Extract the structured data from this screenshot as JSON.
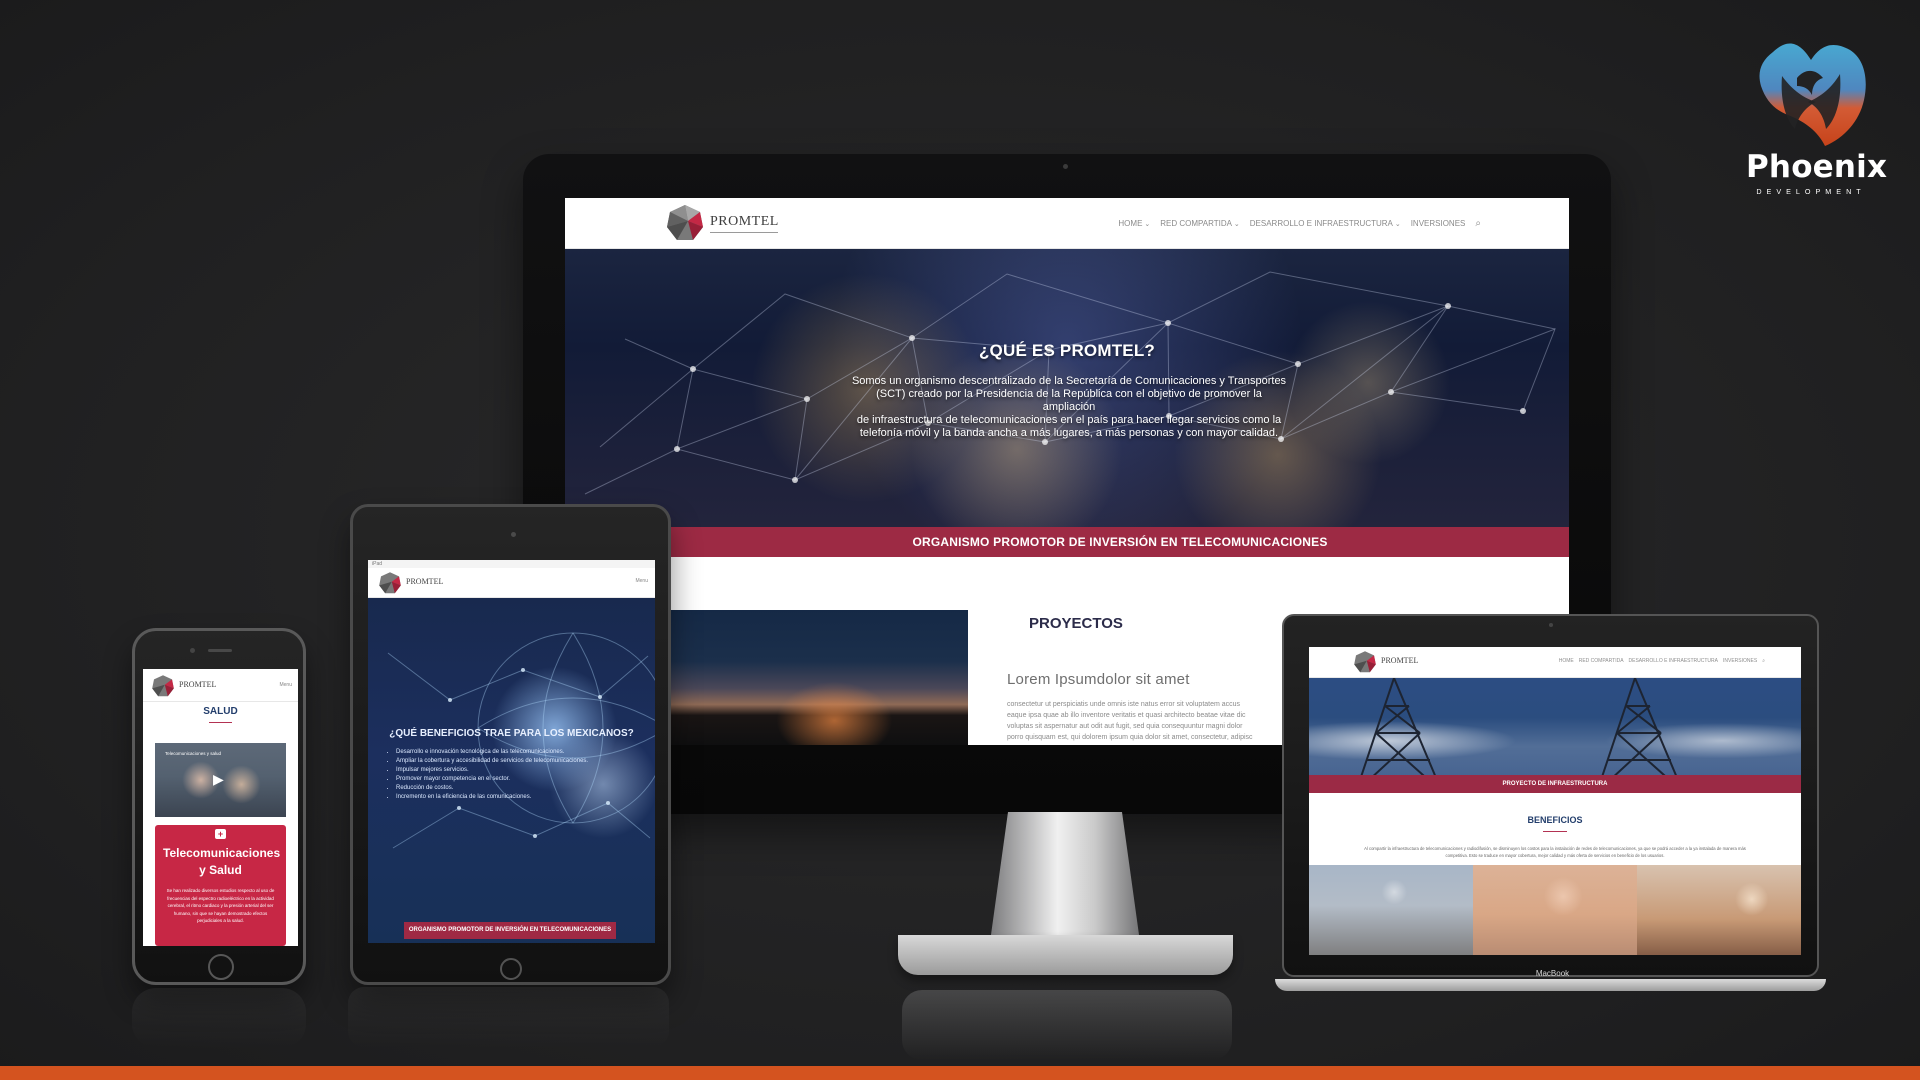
{
  "brand": {
    "name": "Phoenix",
    "tagline": "DEVELOPMENT",
    "accent": "#d4531f"
  },
  "desktop": {
    "logo": {
      "name": "PROMTEL",
      "tagline": "ORGANISMO PROMOTOR DE INVERSIÓN EN TELECOMUNICACIONES"
    },
    "nav": {
      "home": "HOME",
      "shared_network": "RED COMPARTIDA",
      "development": "DESARROLLO E INFRAESTRUCTURA",
      "investments": "INVERSIONES",
      "search": "⌕"
    },
    "hero": {
      "title": "¿QUÉ ES PROMTEL?",
      "line1": "Somos un organismo descentralizado de la Secretaría de Comunicaciones y Transportes",
      "line2": "(SCT) creado por la Presidencia de la República con el objetivo de promover la ampliación",
      "line3": "de infraestructura de telecomunicaciones en el país para hacer llegar servicios como la",
      "line4": "telefonía móvil y la banda ancha a más lugares, a más personas y con mayor calidad.",
      "band": "ORGANISMO PROMOTOR DE INVERSIÓN EN TELECOMUNICACIONES"
    },
    "projects": {
      "title": "PROYECTOS",
      "subtitle": "Lorem Ipsumdolor sit amet",
      "copy1": "consectetur ut perspiciatis unde omnis iste natus error sit voluptatem accus",
      "copy2": "eaque ipsa quae ab illo inventore veritatis et quasi architecto beatae vitae dic",
      "copy3": "voluptas sit aspernatur aut odit aut fugit, sed quia consequuntur magni dolor",
      "copy4": "porro quisquam est, qui dolorem ipsum quia dolor sit amet, consectetur, adipisc"
    }
  },
  "laptop": {
    "brand_label": "MacBook",
    "logo": "PROMTEL",
    "nav": {
      "home": "HOME",
      "shared_network": "RED COMPARTIDA",
      "development": "DESARROLLO E INFRAESTRUCTURA",
      "investments": "INVERSIONES",
      "search": "⌕"
    },
    "band": "PROYECTO DE INFRAESTRUCTURA",
    "benefits_title": "BENEFICIOS",
    "benefits_copy": "Al compartir la infraestructura de telecomunicaciones y radiodifusión, se disminuyen los costos para la instalación de redes de telecomunicaciones, ya que se podrá acceder a la ya instalada de manera más competitiva. Esto se traduce en mayor cobertura, mejor calidad y más oferta de servicios en beneficio de los usuarios."
  },
  "tablet": {
    "status": "iPad",
    "logo": "PROMTEL",
    "menu": "Menu",
    "hero_title": "¿QUÉ BENEFICIOS TRAE PARA LOS MEXICANOS?",
    "benefits": [
      "Desarrollo e innovación tecnológica de las telecomunicaciones.",
      "Ampliar la cobertura y accesibilidad de servicios de telecomunicaciones.",
      "Impulsar mejores servicios.",
      "Promover mayor competencia en el sector.",
      "Reducción de costos.",
      "Incremento en la eficiencia de las comunicaciones."
    ],
    "band": "ORGANISMO PROMOTOR DE INVERSIÓN EN TELECOMUNICACIONES"
  },
  "phone": {
    "logo": "PROMTEL",
    "menu": "Menu",
    "title": "SALUD",
    "video_label": "Telecomunicaciones y salud",
    "card_title": "Telecomunicaciones y Salud",
    "card_copy": "Se han realizado diversos estudios respecto al uso de frecuencias del espectro radioeléctrico en la actividad cerebral, el ritmo cardiaco y la presión arterial del ser humano, sin que se hayan demostrado efectos perjudiciales a la salud."
  }
}
